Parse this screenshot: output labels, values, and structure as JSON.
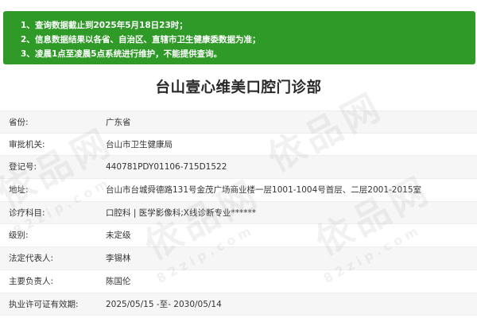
{
  "notice": {
    "lines": [
      {
        "num": "1、",
        "text": "查询数据截止到2025年5月18日23时；"
      },
      {
        "num": "2、",
        "text": "信息数据结果以各省、自治区、直辖市卫生健康委数据为准；"
      },
      {
        "num": "3、",
        "bold": "凌晨1点至凌晨5点",
        "rest": "系统进行维护，不能提供查询。"
      }
    ]
  },
  "title": "台山壹心维美口腔门诊部",
  "rows": [
    {
      "label": "省份:",
      "value": "广东省"
    },
    {
      "label": "审批机关:",
      "value": "台山市卫生健康局"
    },
    {
      "label": "登记号:",
      "value": "440781PDY01106-715D1522"
    },
    {
      "label": "地址:",
      "value": "台山市台城舜德路131号金茂广场商业楼一层1001-1004号首层、二层2001-2015室"
    },
    {
      "label": "诊疗科目:",
      "value": "口腔科 | 医学影像科;X线诊断专业******"
    },
    {
      "label": "级别:",
      "value": "未定级"
    },
    {
      "label": "法定代表人:",
      "value": "李锡林"
    },
    {
      "label": "主要负责人:",
      "value": "陈国伦"
    },
    {
      "label": "执业许可证有效期:",
      "value": "2025/05/15 -至- 2030/05/14"
    }
  ],
  "watermark": {
    "text": "依品网",
    "url": "82zip.com"
  },
  "colors": {
    "notice_bg": "#2f9a27",
    "notice_text": "#ffffff",
    "title_text": "#2a2a2a",
    "row_odd": "#f6f6f6",
    "row_even": "#ffffff"
  }
}
